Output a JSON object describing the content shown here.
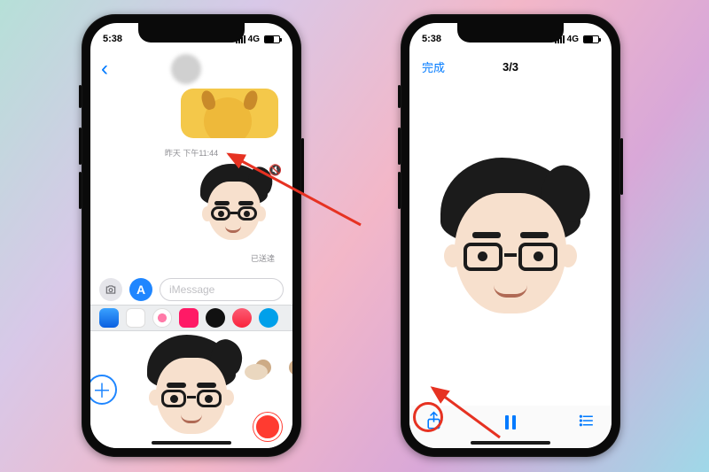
{
  "status": {
    "time": "5:38",
    "network": "4G"
  },
  "left": {
    "timestamp": "昨天 下午11:44",
    "delivered": "已送達",
    "input_placeholder": "iMessage"
  },
  "right": {
    "done": "完成",
    "counter": "3/3"
  }
}
